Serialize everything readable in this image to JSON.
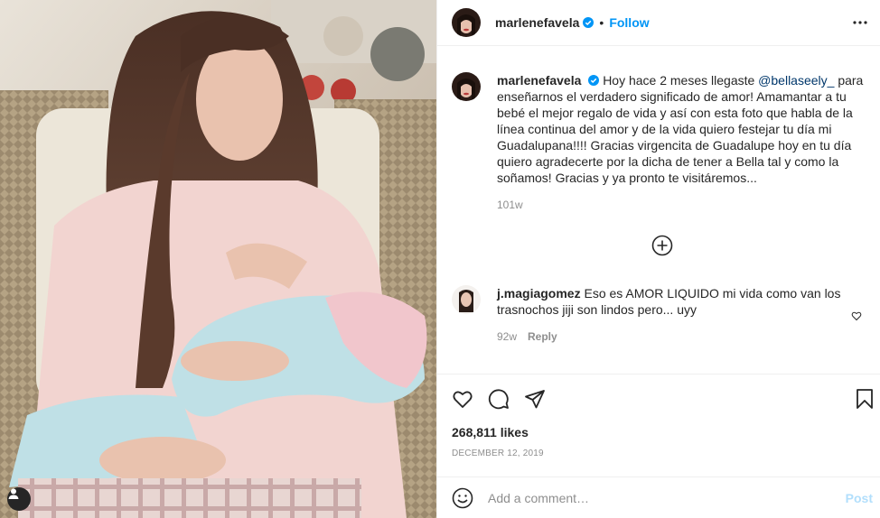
{
  "post": {
    "username": "marlenefavela",
    "follow_label": "Follow",
    "dot": "•"
  },
  "caption": {
    "username": "marlenefavela",
    "text_before_mention": "Hoy hace 2 meses llegaste ",
    "mention": "@bellaseely_",
    "text_after_mention": " para enseñarnos el verdadero significado de amor! Amamantar a tu bebé el mejor regalo de vida y así con esta foto que habla de la línea continua del amor y de la vida quiero festejar tu día mi Guadalupana!!!! Gracias virgencita de Guadalupe hoy en tu día quiero agradecerte por la dicha de tener a Bella tal y como la soñamos! Gracias y ya pronto te visitáremos...",
    "time": "101w"
  },
  "comments": [
    {
      "username": "j.magiagomez",
      "text": "Eso es AMOR LIQUIDO mi vida como van los trasnochos jiji son lindos pero... uyy",
      "time": "92w",
      "reply_label": "Reply"
    }
  ],
  "stats": {
    "likes": "268,811 likes",
    "date": "DECEMBER 12, 2019"
  },
  "composer": {
    "placeholder": "Add a comment…",
    "post_label": "Post"
  },
  "colors": {
    "link": "#0095f6",
    "mention": "#00376b",
    "muted": "#8e8e8e",
    "post_disabled": "#b2dffc"
  },
  "icons": {
    "header": [
      "verified-badge-icon",
      "more-options-icon"
    ],
    "comments": [
      "load-more-plus-icon",
      "comment-like-heart-icon"
    ],
    "actions": [
      "like-heart-icon",
      "comment-bubble-icon",
      "share-paper-plane-icon",
      "save-bookmark-icon"
    ],
    "composer": [
      "emoji-smiley-icon"
    ],
    "photo": [
      "tagged-user-icon"
    ]
  }
}
